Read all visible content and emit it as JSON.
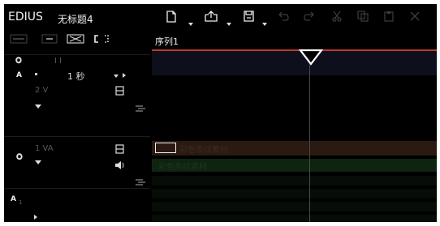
{
  "app": {
    "name": "EDIUS",
    "project_title": "无标题4"
  },
  "sequence": {
    "tab_label": "序列1"
  },
  "tracks": {
    "scale_value": "1 秒",
    "v_track": {
      "label": "2 V"
    },
    "va_track": {
      "label": "1 VA"
    },
    "a_track": {
      "label": "A",
      "number": "1"
    }
  },
  "clips": {
    "video_clip_label": "彩色条纹素材",
    "audio_clip_label": "彩色条纹素材"
  },
  "colors": {
    "accent_red": "#c0392b",
    "video_clip_bg": "#2a1a12",
    "audio_clip_bg": "#0f2410",
    "ruler_bg": "#0d0f1d"
  }
}
